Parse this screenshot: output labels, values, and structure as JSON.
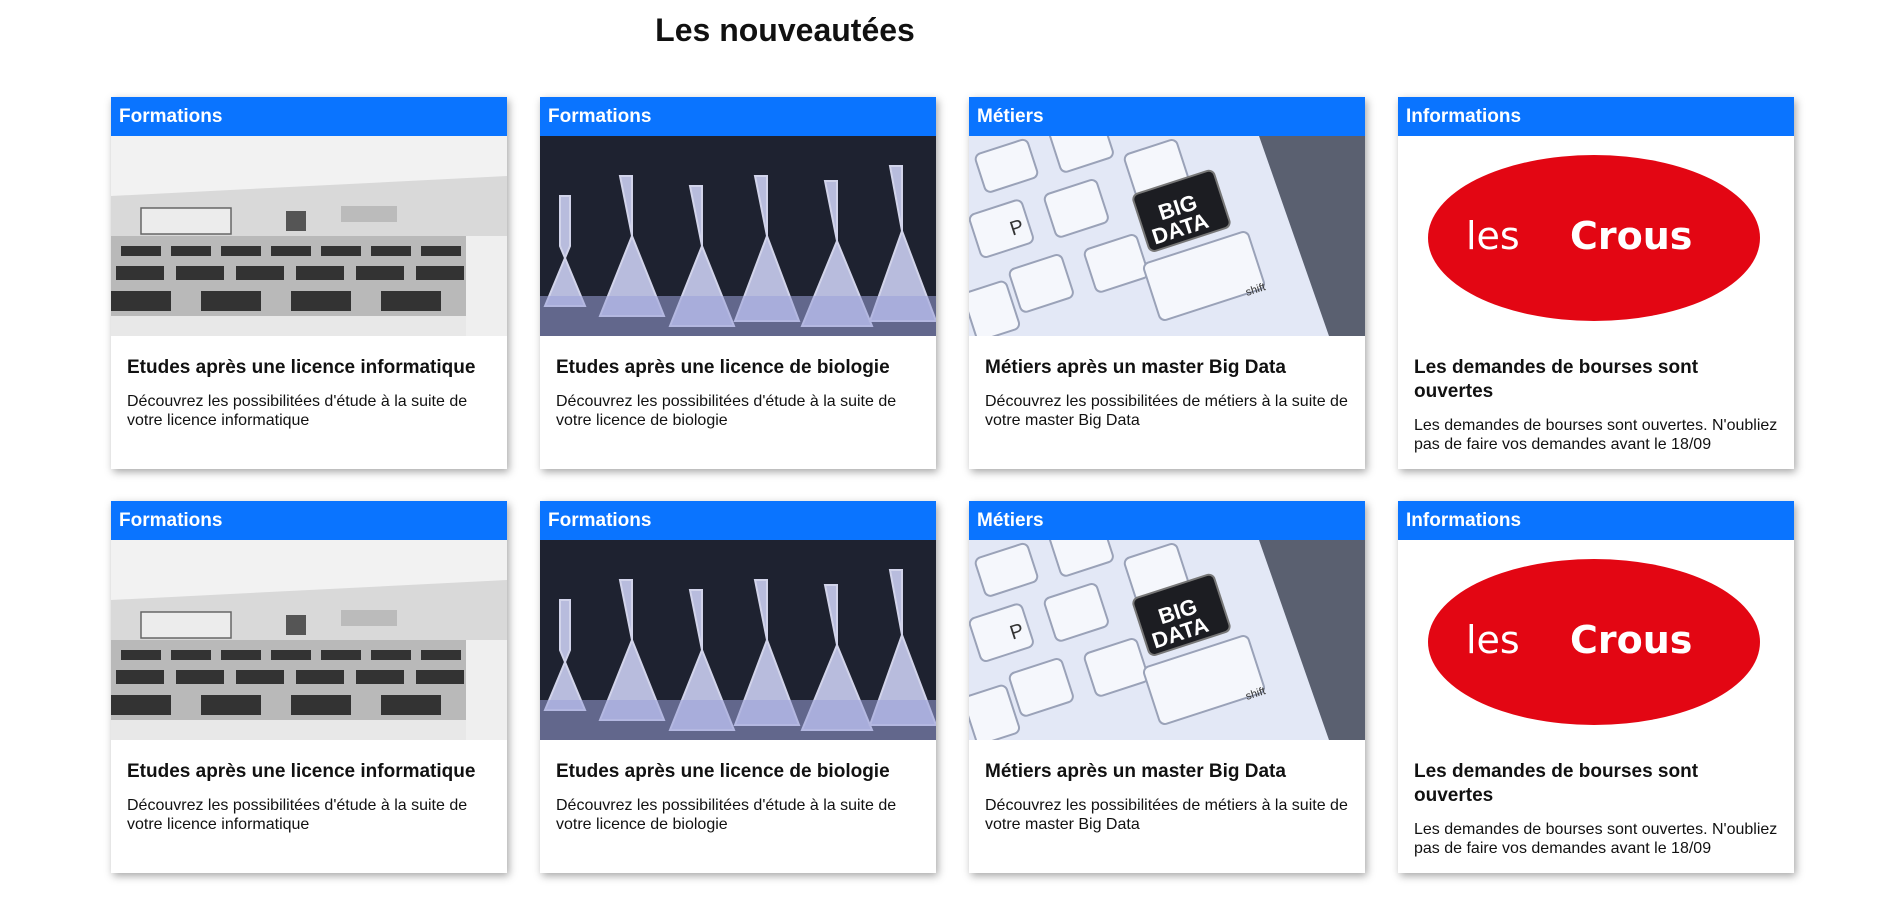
{
  "header": {
    "title": "Les nouveautées"
  },
  "cards": [
    {
      "tag": "Formations",
      "image": "classroom-photo",
      "title": "Etudes après une licence informatique",
      "text": "Découvrez les possibilitées d'étude à la suite de votre licence informatique"
    },
    {
      "tag": "Formations",
      "image": "lab-flasks-photo",
      "title": "Etudes après une licence de biologie",
      "text": "Découvrez les possibilitées d'étude à la suite de votre licence de biologie"
    },
    {
      "tag": "Métiers",
      "image": "big-data-keyboard-photo",
      "title": "Métiers après un master Big Data",
      "text": "Découvrez les possibilitées de métiers à la suite de votre master Big Data"
    },
    {
      "tag": "Informations",
      "image": "crous-logo",
      "title": "Les demandes de bourses sont ouvertes",
      "text": "Les demandes de bourses sont ouvertes. N'oubliez pas de faire vos demandes avant le 18/09"
    },
    {
      "tag": "Formations",
      "image": "classroom-photo",
      "title": "Etudes après une licence informatique",
      "text": "Découvrez les possibilitées d'étude à la suite de votre licence informatique"
    },
    {
      "tag": "Formations",
      "image": "lab-flasks-photo",
      "title": "Etudes après une licence de biologie",
      "text": "Découvrez les possibilitées d'étude à la suite de votre licence de biologie"
    },
    {
      "tag": "Métiers",
      "image": "big-data-keyboard-photo",
      "title": "Métiers après un master Big Data",
      "text": "Découvrez les possibilitées de métiers à la suite de votre master Big Data"
    },
    {
      "tag": "Informations",
      "image": "crous-logo",
      "title": "Les demandes de bourses sont ouvertes",
      "text": "Les demandes de bourses sont ouvertes. N'oubliez pas de faire vos demandes avant le 18/09"
    }
  ],
  "logo_text": {
    "les": "les",
    "crous": "Crous"
  },
  "keyboard_text": {
    "big": "BIG",
    "data": "DATA",
    "shift": "shift",
    "p": "P"
  },
  "colors": {
    "tag_background": "#0a74ff",
    "crous_red": "#e30613"
  }
}
